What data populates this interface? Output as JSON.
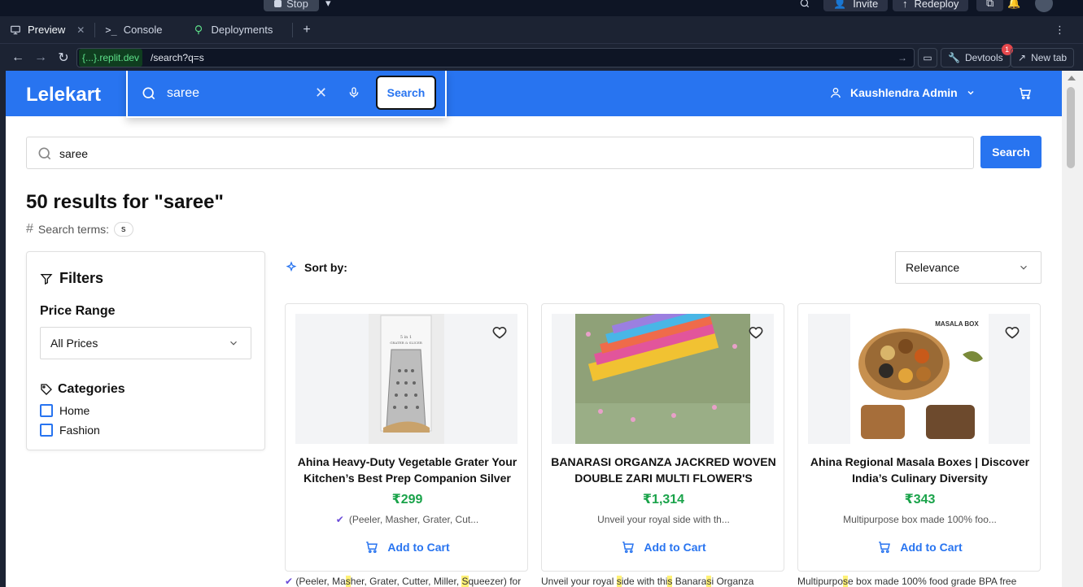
{
  "ide": {
    "stop_label": "Stop",
    "invite_label": "Invite",
    "redeploy_label": "Redeploy",
    "tabs": [
      {
        "label": "Preview"
      },
      {
        "label": "Console"
      },
      {
        "label": "Deployments"
      }
    ],
    "url_host": "{...}.replit.dev",
    "url_path": "/search?q=s",
    "devtools_label": "Devtools",
    "devtools_badge": "1",
    "newtab_label": "New tab"
  },
  "site": {
    "logo": "Lelekart",
    "header_search_value": "saree",
    "header_search_button": "Search",
    "user_name": "Kaushlendra Admin",
    "search_value": "saree",
    "search_button": "Search",
    "results_title": "50 results for \"saree\"",
    "search_terms_label": "Search terms:",
    "search_term_chip": "s",
    "filters": {
      "title": "Filters",
      "price_range_label": "Price Range",
      "price_selected": "All Prices",
      "categories_label": "Categories",
      "categories": [
        "Home",
        "Fashion"
      ]
    },
    "sort": {
      "label": "Sort by:",
      "selected": "Relevance"
    },
    "products": [
      {
        "name": "Ahina Heavy-Duty Vegetable Grater Your Kitchen’s Best Prep Companion Silver",
        "price": "₹299",
        "desc": "(Peeler, Masher, Grater, Cut...",
        "add": "Add to Cart",
        "image_label": "5 in 1 GRATER & SLICER"
      },
      {
        "name": "BANARASI ORGANZA JACKRED WOVEN DOUBLE ZARI MULTI FLOWER'S DESIGNE...",
        "price": "₹1,314",
        "desc": "Unveil your royal side with th...",
        "add": "Add to Cart"
      },
      {
        "name": "Ahina Regional Masala Boxes | Discover India’s Culinary Diversity",
        "price": "₹343",
        "desc": "Multipurpose box made 100% foo...",
        "add": "Add to Cart",
        "image_label": "MASALA BOX"
      }
    ],
    "below_text": [
      [
        "(Peeler, Ma",
        "s",
        "her, Grater, Cutter, Miller, ",
        "S",
        "queezer) for"
      ],
      [
        "Unveil your royal ",
        "s",
        "ide with thi",
        "s",
        " Banara",
        "s",
        "i Organza"
      ],
      [
        "Multipurpo",
        "s",
        "e box made 100% food grade BPA free"
      ]
    ]
  }
}
